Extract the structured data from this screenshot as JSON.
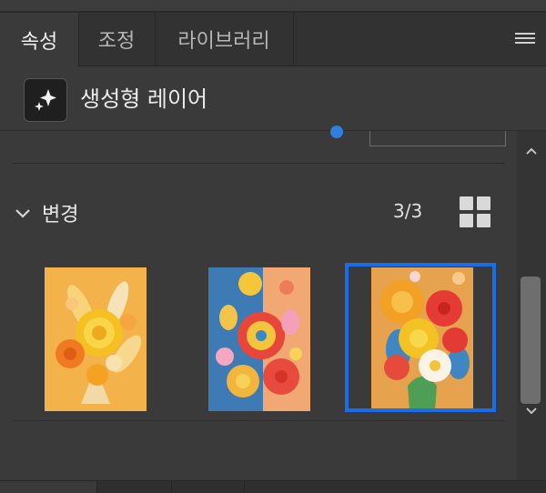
{
  "tabs": [
    {
      "label": "속성",
      "active": true
    },
    {
      "label": "조정",
      "active": false
    },
    {
      "label": "라이브러리",
      "active": false
    }
  ],
  "panel_menu_icon": "hamburger-menu-icon",
  "layer": {
    "icon": "generative-sparkle-icon",
    "title": "생성형 레이어"
  },
  "variations": {
    "section_title": "변경",
    "count": "3/3",
    "view_icon": "grid-view-icon",
    "selected_index": 2,
    "thumbnails": [
      {
        "name": "variation-1",
        "subject": "paper flowers bouquet on orange background"
      },
      {
        "name": "variation-2",
        "subject": "paper flowers on blue and orange background"
      },
      {
        "name": "variation-3",
        "subject": "paper flowers bouquet with red and yellow blooms"
      }
    ]
  },
  "colors": {
    "panel_bg": "#3a3a3a",
    "accent": "#1a6dea",
    "text": "#e6e6e6"
  }
}
